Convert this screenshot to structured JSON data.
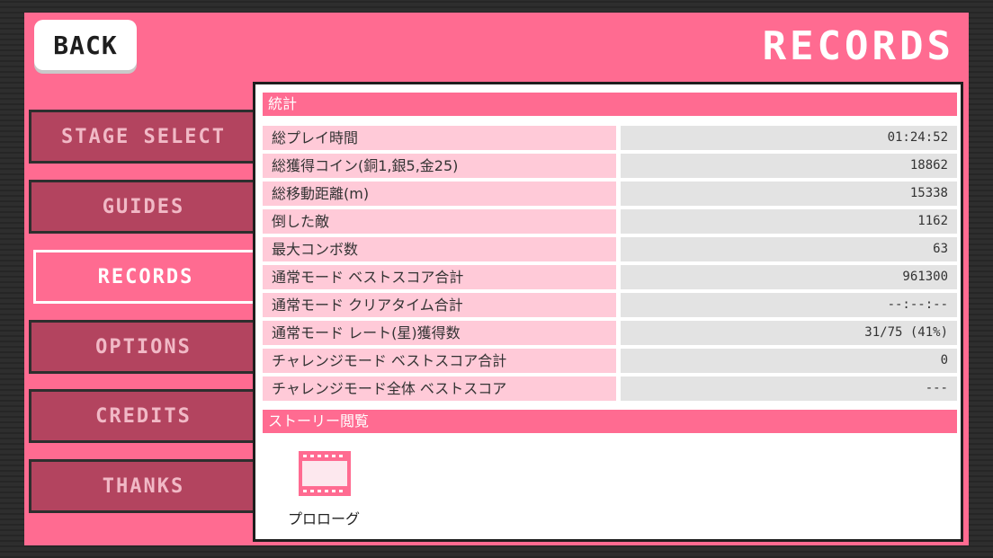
{
  "header": {
    "back_label": "BACK",
    "title": "RECORDS"
  },
  "nav": {
    "items": [
      {
        "label": "STAGE SELECT",
        "active": false
      },
      {
        "label": "GUIDES",
        "active": false
      },
      {
        "label": "RECORDS",
        "active": true
      },
      {
        "label": "OPTIONS",
        "active": false
      },
      {
        "label": "CREDITS",
        "active": false
      },
      {
        "label": "THANKS",
        "active": false
      }
    ]
  },
  "stats_section": {
    "title": "統計",
    "rows": [
      {
        "label": "総プレイ時間",
        "value": "01:24:52"
      },
      {
        "label": "総獲得コイン(銅1,銀5,金25)",
        "value": "18862"
      },
      {
        "label": "総移動距離(m)",
        "value": "15338"
      },
      {
        "label": "倒した敵",
        "value": "1162"
      },
      {
        "label": "最大コンボ数",
        "value": "63"
      },
      {
        "label": "通常モード ベストスコア合計",
        "value": "961300"
      },
      {
        "label": "通常モード クリアタイム合計",
        "value": "--:--:--"
      },
      {
        "label": "通常モード レート(星)獲得数",
        "value": "31/75 (41%)"
      },
      {
        "label": "チャレンジモード ベストスコア合計",
        "value": "0"
      },
      {
        "label": "チャレンジモード全体 ベストスコア",
        "value": "---"
      }
    ]
  },
  "story_section": {
    "title": "ストーリー閲覧",
    "items": [
      {
        "label": "プロローグ",
        "icon": "film-icon"
      }
    ]
  },
  "colors": {
    "frame": "#ff6b91",
    "nav_inactive": "#b3445f",
    "label_bg": "#ffcad8",
    "value_bg": "#e3e3e3"
  }
}
